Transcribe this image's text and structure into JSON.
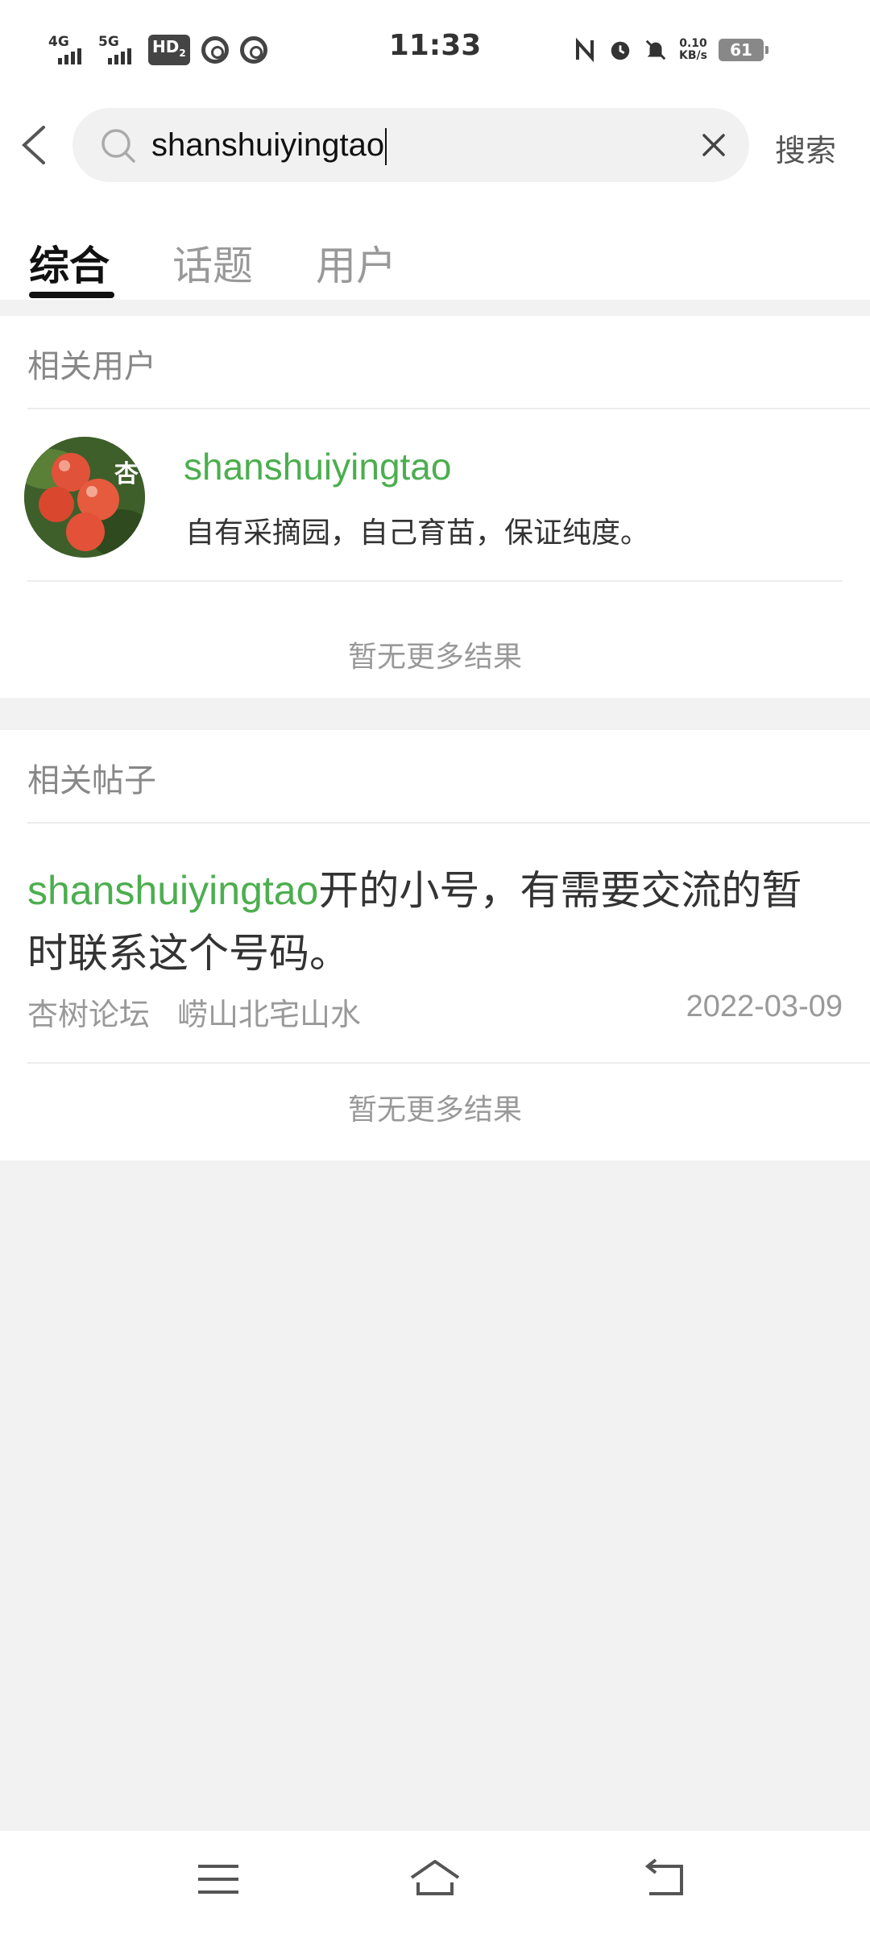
{
  "status_bar": {
    "signal_1": "4G",
    "signal_2": "5G",
    "hd": "HD",
    "hd_sub": "2",
    "time": "11:33",
    "speed_value": "0.10",
    "speed_unit": "KB/s",
    "battery": "61",
    "icons": [
      "nfc-icon",
      "alarm-icon",
      "mute-icon"
    ]
  },
  "search": {
    "query": "shanshuiyingtao",
    "button_label": "搜索"
  },
  "tabs": [
    {
      "label": "综合",
      "active": true
    },
    {
      "label": "话题",
      "active": false
    },
    {
      "label": "用户",
      "active": false
    }
  ],
  "related_users": {
    "header": "相关用户",
    "users": [
      {
        "name": "shanshuiyingtao",
        "bio": "自有采摘园，自己育苗，保证纯度。",
        "avatar_text": "杏"
      }
    ],
    "no_more": "暂无更多结果"
  },
  "related_posts": {
    "header": "相关帖子",
    "posts": [
      {
        "title_keyword": "shanshuiyingtao",
        "title_rest": "开的小号，有需要交流的暂时联系这个号码。",
        "forum": "杏树论坛",
        "author": "崂山北宅山水",
        "date": "2022-03-09"
      }
    ],
    "no_more": "暂无更多结果"
  },
  "colors": {
    "accent_green": "#4cae4f",
    "page_bg": "#f2f2f2"
  }
}
